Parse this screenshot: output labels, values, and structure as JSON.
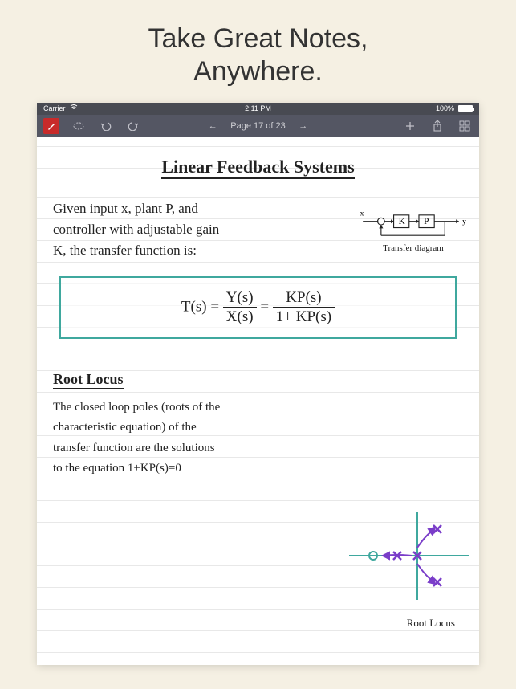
{
  "promo": {
    "heading_line1": "Take Great Notes,",
    "heading_line2": "Anywhere."
  },
  "status_bar": {
    "carrier": "Carrier",
    "time": "2:11 PM",
    "battery": "100%"
  },
  "toolbar": {
    "page_label": "Page 17 of 23"
  },
  "note": {
    "title": "Linear Feedback Systems",
    "paragraph1_line1": "Given input x, plant P, and",
    "paragraph1_line2": "controller with adjustable gain",
    "paragraph1_line3": "K, the transfer function is:",
    "diagram1_label": "Transfer diagram",
    "diagram1_x": "x",
    "diagram1_y": "y",
    "diagram1_K": "K",
    "diagram1_P": "P",
    "formula_lhs": "T(s)",
    "formula_mid_num": "Y(s)",
    "formula_mid_den": "X(s)",
    "formula_rhs_num": "KP(s)",
    "formula_rhs_den": "1+ KP(s)",
    "subheading": "Root Locus",
    "paragraph2_line1": "The closed loop poles (roots of the",
    "paragraph2_line2": "characteristic equation) of the",
    "paragraph2_line3": "transfer function are the solutions",
    "paragraph2_line4": "to the equation 1+KP(s)=0",
    "diagram2_label": "Root Locus"
  }
}
